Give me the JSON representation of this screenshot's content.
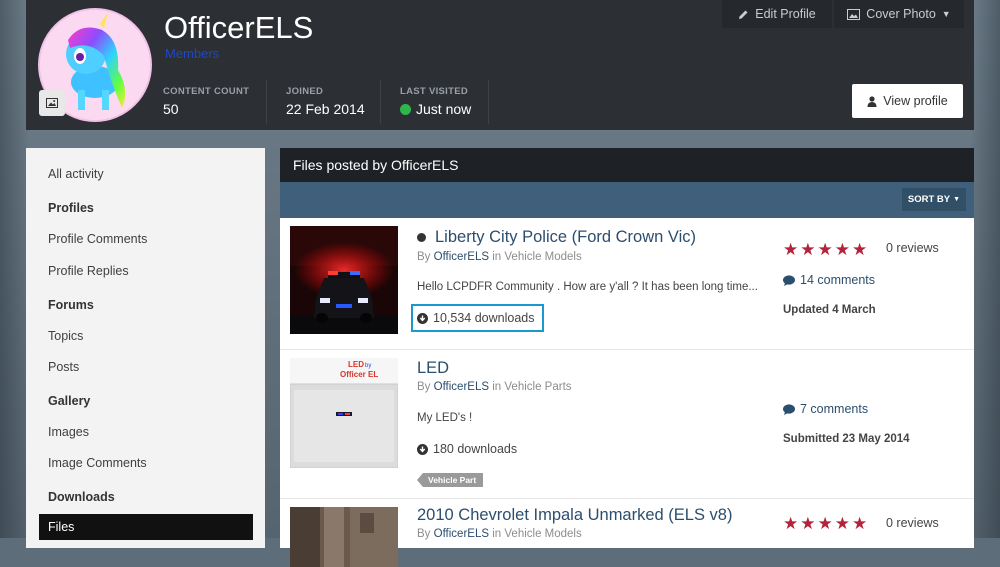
{
  "profile": {
    "username": "OfficerELS",
    "group": "Members",
    "stats": [
      {
        "label": "CONTENT COUNT",
        "value": "50"
      },
      {
        "label": "JOINED",
        "value": "22 Feb 2014"
      },
      {
        "label": "LAST VISITED",
        "value": "Just now"
      }
    ],
    "edit_profile_label": "Edit Profile",
    "cover_photo_label": "Cover Photo",
    "view_profile_label": "View profile"
  },
  "sidebar": {
    "items": [
      {
        "label": "All activity"
      },
      {
        "label": "Profiles"
      },
      {
        "label": "Profile Comments"
      },
      {
        "label": "Profile Replies"
      },
      {
        "label": "Forums"
      },
      {
        "label": "Topics"
      },
      {
        "label": "Posts"
      },
      {
        "label": "Gallery"
      },
      {
        "label": "Images"
      },
      {
        "label": "Image Comments"
      },
      {
        "label": "Downloads"
      },
      {
        "label": "Files"
      }
    ]
  },
  "main": {
    "title": "Files posted by OfficerELS",
    "sort_label": "SORT BY",
    "by_prefix": "By",
    "in_word": "in",
    "files": [
      {
        "title": "Liberty City Police (Ford Crown Vic)",
        "author": "OfficerELS",
        "category": "Vehicle Models",
        "snippet": "Hello LCPDFR Community . How are y'all ? It has been long time...",
        "downloads": "10,534 downloads",
        "rating": 5,
        "reviews": "0 reviews",
        "comments": "14 comments",
        "date": "Updated 4 March"
      },
      {
        "title": "LED",
        "author": "OfficerELS",
        "category": "Vehicle Parts",
        "snippet": "My LED's !",
        "downloads": "180 downloads",
        "comments": "7 comments",
        "date": "Submitted 23 May 2014",
        "tag": "Vehicle Part",
        "thumb_text_top": "LED",
        "thumb_text_by": "by",
        "thumb_text_bottom": "Officer EL"
      },
      {
        "title": "2010 Chevrolet Impala Unmarked (ELS v8)",
        "author": "OfficerELS",
        "category": "Vehicle Models",
        "rating": 5,
        "reviews": "0 reviews"
      }
    ]
  },
  "colors": {
    "star": "#b3243b",
    "link": "#2c4e6e",
    "highlight": "#1a98d0",
    "online": "#2db74a"
  }
}
